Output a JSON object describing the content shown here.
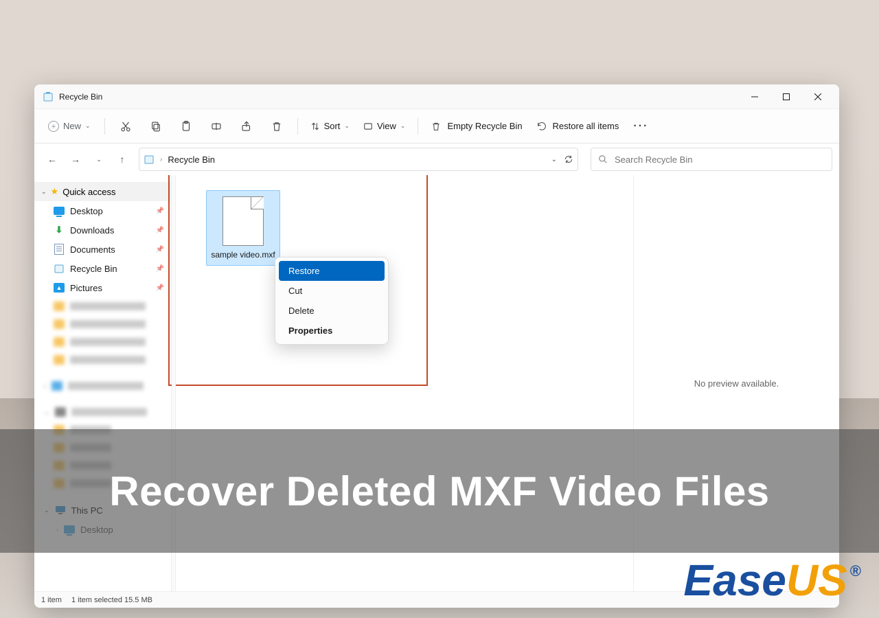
{
  "window": {
    "title": "Recycle Bin"
  },
  "toolbar": {
    "new_label": "New",
    "sort_label": "Sort",
    "view_label": "View",
    "empty_label": "Empty Recycle Bin",
    "restore_all_label": "Restore all items"
  },
  "address": {
    "crumb": "Recycle Bin"
  },
  "search": {
    "placeholder": "Search Recycle Bin"
  },
  "sidebar": {
    "quick_access": "Quick access",
    "items": [
      {
        "label": "Desktop"
      },
      {
        "label": "Downloads"
      },
      {
        "label": "Documents"
      },
      {
        "label": "Recycle Bin"
      },
      {
        "label": "Pictures"
      }
    ],
    "this_pc": "This PC",
    "desktop_sub": "Desktop"
  },
  "file": {
    "name": "sample video.mxf"
  },
  "context_menu": {
    "restore": "Restore",
    "cut": "Cut",
    "delete": "Delete",
    "properties": "Properties"
  },
  "preview": {
    "none": "No preview available."
  },
  "status": {
    "count": "1 item",
    "selected": "1 item selected  15.5 MB"
  },
  "banner": {
    "headline": "Recover Deleted MXF Video Files"
  },
  "logo": {
    "p1": "Ease",
    "p2": "US",
    "reg": "®"
  }
}
